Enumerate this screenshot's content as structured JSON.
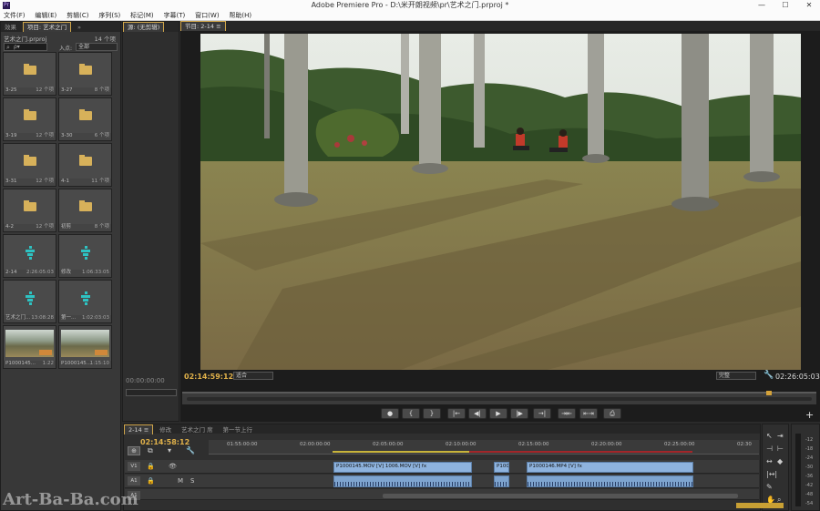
{
  "window": {
    "title": "Adobe Premiere Pro - D:\\米开朗视频\\pr\\艺术之门.prproj *",
    "logo": "Pr",
    "minimize": "—",
    "maximize": "☐",
    "close": "✕"
  },
  "menu": [
    "文件(F)",
    "编辑(E)",
    "剪辑(C)",
    "序列(S)",
    "标记(M)",
    "字幕(T)",
    "窗口(W)",
    "帮助(H)"
  ],
  "project_panel": {
    "tabs": [
      "效果",
      "项目: 艺术之门",
      "»"
    ],
    "name": "艺术之门.prproj",
    "count": "14 个项",
    "search_placeholder": "ρ▾",
    "in_label": "入点:",
    "in_value": "全部",
    "items": [
      {
        "name": "3-25",
        "duration": "12 个项",
        "kind": "folder"
      },
      {
        "name": "3-27",
        "duration": "8 个项",
        "kind": "folder"
      },
      {
        "name": "3-19",
        "duration": "12 个项",
        "kind": "folder"
      },
      {
        "name": "3-30",
        "duration": "6 个项",
        "kind": "folder"
      },
      {
        "name": "3-31",
        "duration": "12 个项",
        "kind": "folder"
      },
      {
        "name": "4-1",
        "duration": "11 个项",
        "kind": "folder"
      },
      {
        "name": "4-2",
        "duration": "12 个项",
        "kind": "folder"
      },
      {
        "name": "初剪",
        "duration": "8 个项",
        "kind": "folder"
      },
      {
        "name": "2-14",
        "duration": "2:26:05:03",
        "kind": "sequence"
      },
      {
        "name": "修改",
        "duration": "1:06:33:05",
        "kind": "sequence"
      },
      {
        "name": "艺术之门...",
        "duration": "13:08:28",
        "kind": "sequence"
      },
      {
        "name": "第一...",
        "duration": "1:02:03:03",
        "kind": "sequence"
      },
      {
        "name": "P1000145...",
        "duration": "1:22",
        "kind": "video"
      },
      {
        "name": "P1000145...",
        "duration": "1:15:10",
        "kind": "video"
      }
    ]
  },
  "source_panel": {
    "tab": "源: (无剪辑)",
    "timecode": "00:00:00:00"
  },
  "program_panel": {
    "tab": "节目: 2-14 ≡",
    "timecode_current": "02:14:59:12",
    "fit_label": "适合",
    "quality_label": "完整",
    "timecode_duration": "02:26:05:03",
    "controls": [
      "●",
      "{",
      "}",
      "|←",
      "◀|",
      "▶",
      "|▶",
      "→|",
      "⇥⇤",
      "⇤⇥",
      "⎙"
    ],
    "add": "+"
  },
  "timeline": {
    "tabs": [
      "2-14 ≡",
      "修改",
      "艺术之门 席",
      "第一节上行"
    ],
    "timecode": "02:14:58:12",
    "ruler_labels": [
      "01:55:00:00",
      "02:00:00:00",
      "02:05:00:00",
      "02:10:00:00",
      "02:15:00:00",
      "02:20:00:00",
      "02:25:00:00",
      "02:30"
    ],
    "tracks": [
      {
        "name": "V1",
        "kind": "video"
      },
      {
        "name": "A1",
        "kind": "audio"
      },
      {
        "name": "A1",
        "kind": "audio"
      }
    ],
    "clips": [
      {
        "label": "P1000145.MOV [V] 1006.MOV [V] fx",
        "kind": "video"
      },
      {
        "label": "P1000",
        "kind": "video"
      },
      {
        "label": "P1000146.MP4 [V] fx",
        "kind": "video"
      }
    ]
  },
  "meters": {
    "labels": [
      "-12",
      "-18",
      "-24",
      "-30",
      "-36",
      "-42",
      "-48",
      "-54"
    ]
  },
  "watermark": "Art-Ba-Ba.com",
  "colors": {
    "accent_timecode": "#e0b14a",
    "folder": "#d7b15a",
    "sequence_icon": "#2ec2c2",
    "clip": "#8eb3de",
    "in_out_bar": "#a3262a"
  }
}
